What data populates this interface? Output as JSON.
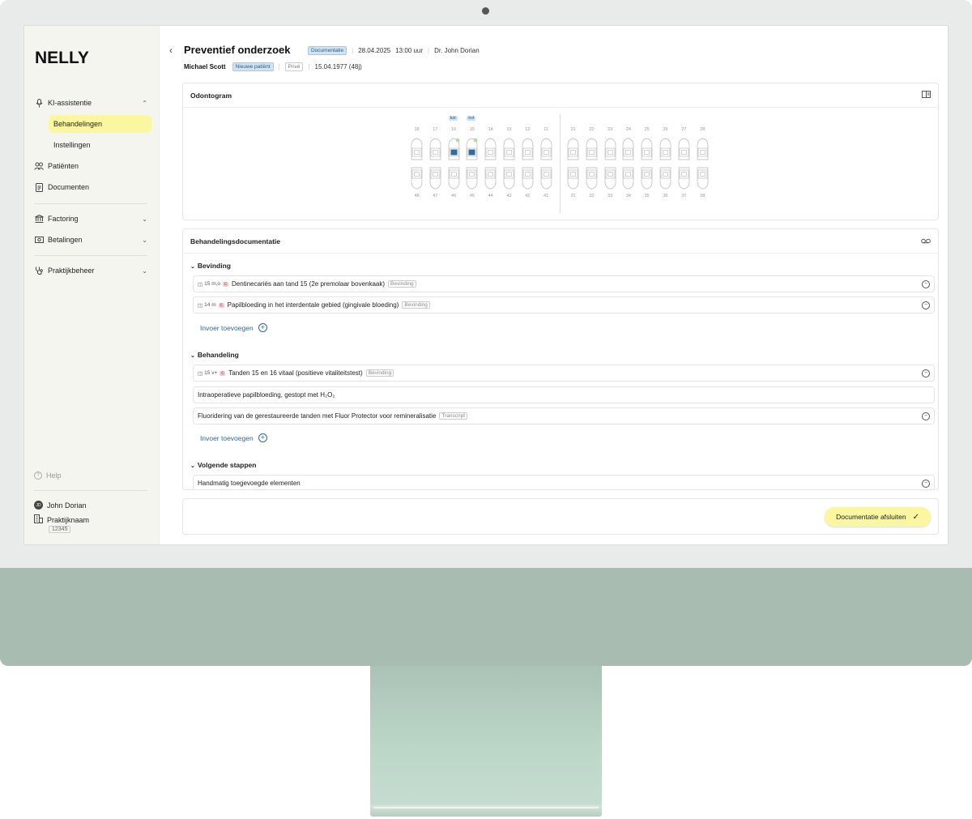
{
  "app": {
    "logo": "NELLY"
  },
  "sidebar": {
    "ki": {
      "label": "KI-assistentie"
    },
    "sub": [
      {
        "label": "Behandelingen"
      },
      {
        "label": "Instellingen"
      }
    ],
    "items": [
      {
        "label": "Patiënten"
      },
      {
        "label": "Documenten"
      }
    ],
    "groups": [
      {
        "label": "Factoring"
      },
      {
        "label": "Betalingen"
      },
      {
        "label": "Praktijkbeheer"
      }
    ],
    "help": "Help",
    "user": {
      "initials": "JD",
      "name": "John Dorian"
    },
    "practice": {
      "name": "Praktijknaam",
      "code": "12345"
    }
  },
  "header": {
    "title": "Preventief onderzoek",
    "status_badge": "Documentatie",
    "date": "28.04.2025",
    "time": "13:00 uur",
    "doctor": "Dr. John Dorian",
    "patient": "Michael Scott",
    "patient_badge": "Nieuwe patiënt",
    "insurance": "Privé",
    "dob": "15.04.1977 (48j)"
  },
  "odontogram": {
    "title": "Odontogram",
    "upper_right": [
      "18",
      "17",
      "16",
      "15",
      "14",
      "13",
      "12",
      "11"
    ],
    "upper_left": [
      "21",
      "22",
      "23",
      "24",
      "25",
      "26",
      "27",
      "28"
    ],
    "lower_right": [
      "48",
      "47",
      "46",
      "45",
      "44",
      "43",
      "42",
      "41"
    ],
    "lower_left": [
      "31",
      "32",
      "33",
      "34",
      "35",
      "36",
      "37",
      "38"
    ],
    "kst_labels": [
      "kst",
      "kst"
    ]
  },
  "documentation": {
    "title": "Behandelingsdocumentatie",
    "sections": [
      {
        "title": "Bevinding",
        "rows": [
          {
            "tooth": "15 m,o",
            "code": "c",
            "text": "Dentinecariës aan tand 15 (2e premolaar bovenkaak)",
            "ref": "Bevinding"
          },
          {
            "tooth": "14 m",
            "code": "c",
            "text": "Papilbloeding in het interdentale gebied (gingivale bloeding)",
            "ref": "Bevinding"
          }
        ],
        "add": "Invoer toevoegen"
      },
      {
        "title": "Behandeling",
        "rows": [
          {
            "tooth": "15 v+",
            "code": "c",
            "text": "Tanden 15 en 16 vitaal (positieve vitaliteitstest)",
            "ref": "Bevinding"
          },
          {
            "text": "Intraoperatieve papilbloeding, gestopt met H₂O₂"
          },
          {
            "text": "Fluoridering van de gerestaureerde tanden met Fluor Protector voor remineralisatie",
            "ref": "Transcript"
          }
        ],
        "add": "Invoer toevoegen"
      },
      {
        "title": "Volgende stappen",
        "rows": [
          {
            "text": "Handmatig toegevoegde elementen"
          }
        ]
      }
    ]
  },
  "footer": {
    "close_button": "Documentatie afsluiten"
  }
}
